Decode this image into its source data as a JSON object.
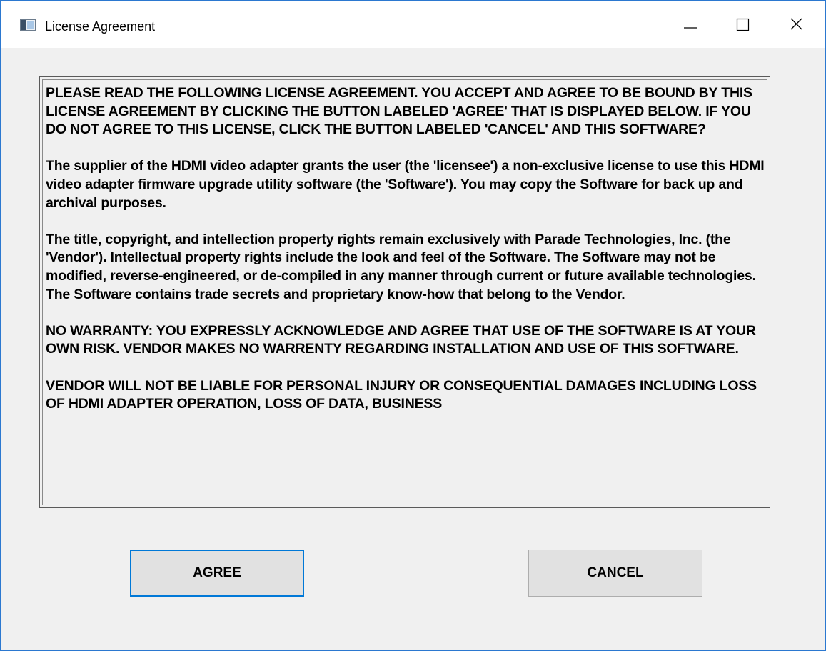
{
  "window": {
    "title": "License Agreement",
    "icon": "app-window-icon",
    "controls": {
      "minimize": "minimize-icon",
      "maximize": "maximize-icon",
      "close": "close-icon"
    }
  },
  "license": {
    "paragraphs": [
      "PLEASE READ THE FOLLOWING LICENSE AGREEMENT. YOU ACCEPT AND AGREE TO BE BOUND BY THIS LICENSE AGREEMENT BY CLICKING THE BUTTON LABELED 'AGREE' THAT IS DISPLAYED BELOW. IF YOU DO NOT AGREE TO THIS LICENSE, CLICK THE BUTTON LABELED 'CANCEL' AND THIS SOFTWARE?",
      "The supplier of the HDMI video adapter grants the user (the 'licensee') a non-exclusive license to use this HDMI video adapter firmware upgrade utility software (the 'Software'). You may copy the Software for back up and archival purposes.",
      "The title, copyright, and intellection property rights remain exclusively with Parade Technologies, Inc. (the 'Vendor'). Intellectual property rights include the look and feel of the Software. The Software may not be modified, reverse-engineered, or de-compiled in any manner through current or future available technologies. The Software contains trade secrets and proprietary know-how that belong to the Vendor.",
      "NO WARRANTY: YOU EXPRESSLY ACKNOWLEDGE AND AGREE THAT USE OF THE SOFTWARE IS AT YOUR OWN RISK. VENDOR MAKES NO WARRENTY REGARDING INSTALLATION AND USE OF THIS SOFTWARE.",
      "VENDOR WILL NOT BE LIABLE FOR PERSONAL INJURY OR CONSEQUENTIAL DAMAGES INCLUDING LOSS OF HDMI ADAPTER OPERATION, LOSS OF DATA, BUSINESS"
    ]
  },
  "buttons": {
    "agree_label": "AGREE",
    "cancel_label": "CANCEL"
  },
  "colors": {
    "window_border": "#2b78d0",
    "focus_border": "#0078d7",
    "button_face": "#e1e1e1",
    "dialog_background": "#f0f0f0"
  }
}
